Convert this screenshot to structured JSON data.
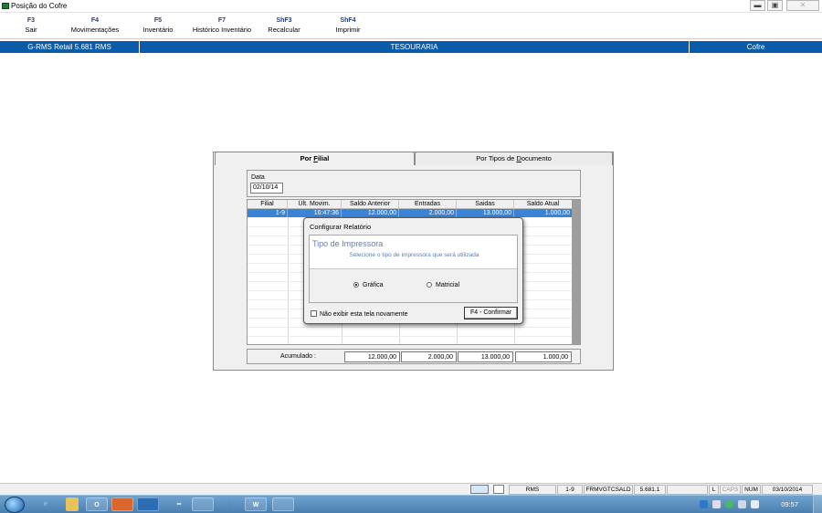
{
  "window": {
    "title": "Posição do Cofre",
    "controls": [
      "minimize-icon",
      "maximize-icon",
      "close-icon"
    ]
  },
  "fkeys": [
    {
      "key": "F3",
      "label": "Sair"
    },
    {
      "key": "F4",
      "label": "Movimentações"
    },
    {
      "key": "F5",
      "label": "Inventário"
    },
    {
      "key": "F7",
      "label": "Histórico Inventário"
    },
    {
      "key": "ShF3",
      "label": "Recalcular"
    },
    {
      "key": "ShF4",
      "label": "Imprimir"
    }
  ],
  "header": {
    "system": "G-RMS Retail 5.681 RMS",
    "module": "TESOURARIA",
    "screen": "Cofre",
    "color": "#0a5ca8"
  },
  "tabs": {
    "active_pre": "Por ",
    "active_u": "F",
    "active_post": "ilial",
    "inactive_pre": "Por Tipos de ",
    "inactive_u": "D",
    "inactive_post": "ocumento"
  },
  "date": {
    "label": "Data",
    "value": "02/10/14"
  },
  "grid": {
    "columns": [
      "Filial",
      "Últ. Movim.",
      "Saldo Anterior",
      "Entradas",
      "Saidas",
      "Saldo Atual"
    ],
    "rows": [
      [
        "1-9",
        "16:47:36",
        "12.000,00",
        "2.000,00",
        "13.000,00",
        "1.000,00"
      ]
    ],
    "selection_color": "#3a84d8"
  },
  "totals": {
    "label": "Acumulado :",
    "values": [
      "12.000,00",
      "2.000,00",
      "13.000,00",
      "1.000,00"
    ]
  },
  "dialog": {
    "title": "Configurar Relatório",
    "group_title": "Tipo de Impressora",
    "group_subtitle": "Selecione o tipo de impressora que será utilizada",
    "options": [
      {
        "label": "Gráfica",
        "selected": true
      },
      {
        "label": "Matricial",
        "selected": false
      }
    ],
    "checkbox_label": "Não exibir esta tela novamente",
    "checkbox_checked": false,
    "confirm_button": "F4 - Confirmar"
  },
  "statusbar": {
    "fields": [
      "RMS",
      "1-9",
      "FRMVGTCSALD",
      "5.681.1",
      "",
      "L",
      "CAPS",
      "NUM",
      "03/10/2014"
    ]
  },
  "taskbar": {
    "apps": [
      "ie-icon",
      "explorer-icon",
      "outlook-icon",
      "firefox-icon",
      "app-icon",
      "link-icon",
      "rms-icon",
      "lync-icon",
      "word-icon",
      "rms-icon"
    ],
    "clock": "09:57"
  }
}
